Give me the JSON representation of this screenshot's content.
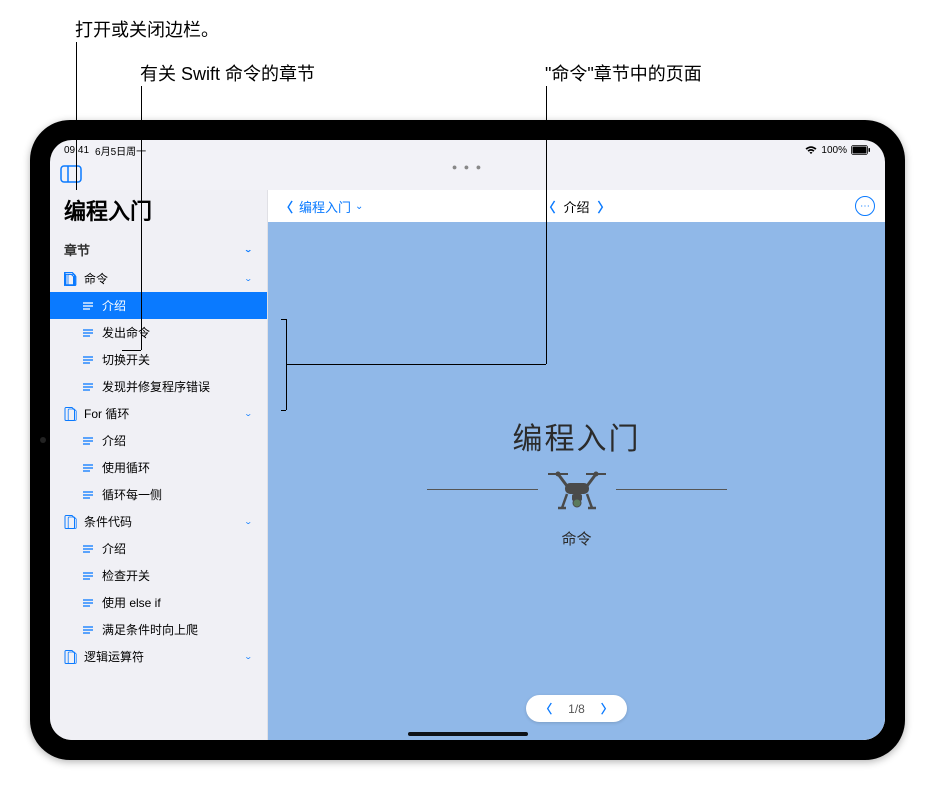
{
  "callouts": {
    "c1": "打开或关闭边栏。",
    "c2": "有关 Swift 命令的章节",
    "c3": "\"命令\"章节中的页面"
  },
  "status": {
    "time": "09:41",
    "date": "6月5日周一",
    "battery_pct": "100%"
  },
  "sidebar": {
    "title": "编程入门",
    "section_label": "章节",
    "chapters": [
      {
        "label": "命令",
        "expanded": true,
        "pages": [
          "介绍",
          "发出命令",
          "切换开关",
          "发现并修复程序错误"
        ]
      },
      {
        "label": "For 循环",
        "expanded": true,
        "pages": [
          "介绍",
          "使用循环",
          "循环每一侧"
        ]
      },
      {
        "label": "条件代码",
        "expanded": true,
        "pages": [
          "介绍",
          "检查开关",
          "使用 else if",
          "满足条件时向上爬"
        ]
      },
      {
        "label": "逻辑运算符",
        "expanded": true,
        "pages": []
      }
    ]
  },
  "content": {
    "breadcrumb": "编程入门",
    "page_nav_label": "介绍",
    "main_title": "编程入门",
    "subtitle": "命令",
    "pager": "1/8"
  },
  "colors": {
    "accent": "#0a7aff",
    "content_bg": "#90b8e8"
  }
}
